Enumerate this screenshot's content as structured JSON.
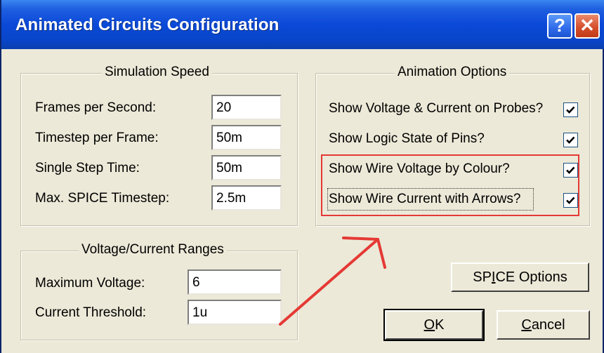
{
  "window": {
    "title": "Animated Circuits Configuration"
  },
  "titlebar_buttons": {
    "help": "?",
    "close": "✕"
  },
  "simulation_speed": {
    "title": "Simulation Speed",
    "rows": [
      {
        "label": "Frames per Second:",
        "value": "20"
      },
      {
        "label": "Timestep per Frame:",
        "value": "50m"
      },
      {
        "label": "Single Step Time:",
        "value": "50m"
      },
      {
        "label": "Max. SPICE Timestep:",
        "value": "2.5m"
      }
    ]
  },
  "ranges": {
    "title": "Voltage/Current Ranges",
    "rows": [
      {
        "label": "Maximum Voltage:",
        "value": "6"
      },
      {
        "label": "Current Threshold:",
        "value": "1u"
      }
    ]
  },
  "animation_options": {
    "title": "Animation Options",
    "options": [
      {
        "label": "Show Voltage & Current on Probes?",
        "checked": true
      },
      {
        "label": "Show Logic State of Pins?",
        "checked": true
      },
      {
        "label": "Show Wire Voltage by Colour?",
        "checked": true
      },
      {
        "label": "Show Wire Current with Arrows?",
        "checked": true
      }
    ]
  },
  "buttons": {
    "spice_options_pre": "SP",
    "spice_options_key": "I",
    "spice_options_post": "CE Options",
    "ok_key": "O",
    "ok_post": "K",
    "cancel_key": "C",
    "cancel_post": "ancel"
  },
  "colors": {
    "titlebar": "#0b49d8",
    "annotation": "#e53935",
    "dialog_bg": "#ece9d8"
  },
  "icons": {
    "help": "help-icon",
    "close": "close-icon",
    "check": "checkmark-icon"
  }
}
